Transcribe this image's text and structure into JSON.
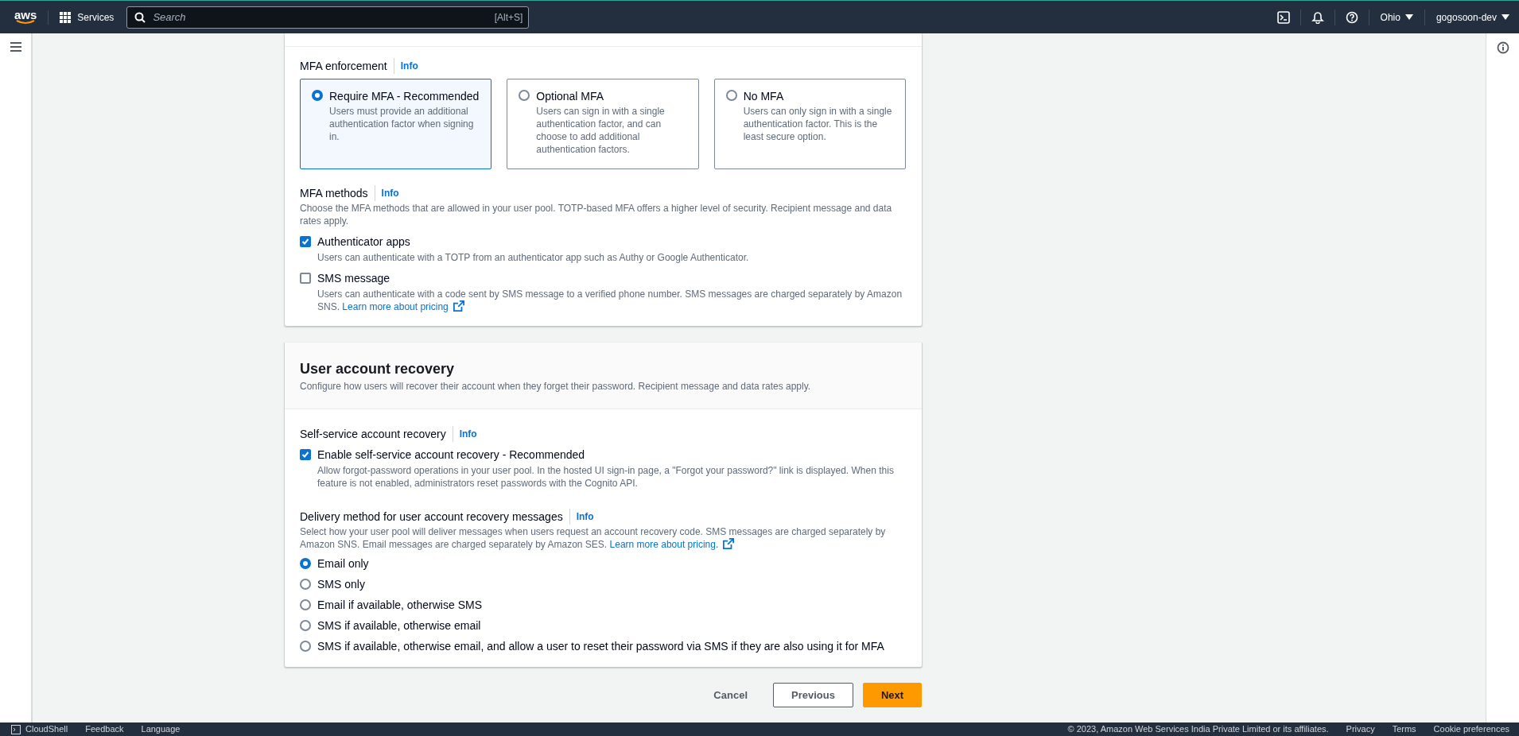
{
  "top_nav": {
    "logo": "aws",
    "services": "Services",
    "search": {
      "placeholder": "Search",
      "shortcut": "[Alt+S]"
    },
    "region": "Ohio",
    "account": "gogosoon-dev"
  },
  "mfa_section": {
    "enforcement": {
      "label": "MFA enforcement",
      "info": "Info",
      "options": [
        {
          "title": "Require MFA - Recommended",
          "description": "Users must provide an additional authentication factor when signing in.",
          "selected": true
        },
        {
          "title": "Optional MFA",
          "description": "Users can sign in with a single authentication factor, and can choose to add additional authentication factors.",
          "selected": false
        },
        {
          "title": "No MFA",
          "description": "Users can only sign in with a single authentication factor. This is the least secure option.",
          "selected": false
        }
      ]
    },
    "methods": {
      "label": "MFA methods",
      "info": "Info",
      "description": "Choose the MFA methods that are allowed in your user pool. TOTP-based MFA offers a higher level of security. Recipient message and data rates apply.",
      "options": [
        {
          "label": "Authenticator apps",
          "description": "Users can authenticate with a TOTP from an authenticator app such as Authy or Google Authenticator.",
          "checked": true
        },
        {
          "label": "SMS message",
          "description": "Users can authenticate with a code sent by SMS message to a verified phone number. SMS messages are charged separately by Amazon SNS.",
          "link": "Learn more about pricing",
          "checked": false
        }
      ]
    }
  },
  "recovery_section": {
    "title": "User account recovery",
    "description": "Configure how users will recover their account when they forget their password. Recipient message and data rates apply.",
    "self_service": {
      "label": "Self-service account recovery",
      "info": "Info",
      "option": {
        "label": "Enable self-service account recovery - Recommended",
        "description": "Allow forgot-password operations in your user pool. In the hosted UI sign-in page, a \"Forgot your password?\" link is displayed. When this feature is not enabled, administrators reset passwords with the Cognito API.",
        "checked": true
      }
    },
    "delivery": {
      "label": "Delivery method for user account recovery messages",
      "info": "Info",
      "description": "Select how your user pool will deliver messages when users request an account recovery code. SMS messages are charged separately by Amazon SNS. Email messages are charged separately by Amazon SES.",
      "link": "Learn more about pricing.",
      "options": [
        {
          "label": "Email only",
          "selected": true
        },
        {
          "label": "SMS only",
          "selected": false
        },
        {
          "label": "Email if available, otherwise SMS",
          "selected": false
        },
        {
          "label": "SMS if available, otherwise email",
          "selected": false
        },
        {
          "label": "SMS if available, otherwise email, and allow a user to reset their password via SMS if they are also using it for MFA",
          "selected": false
        }
      ]
    }
  },
  "actions": [
    {
      "label": "Cancel",
      "kind": "link"
    },
    {
      "label": "Previous",
      "kind": "secondary"
    },
    {
      "label": "Next",
      "kind": "primary"
    }
  ],
  "footer": {
    "left": [
      "CloudShell",
      "Feedback",
      "Language"
    ],
    "copyright": "© 2023, Amazon Web Services India Private Limited or its affiliates.",
    "right": [
      "Privacy",
      "Terms",
      "Cookie preferences"
    ]
  }
}
